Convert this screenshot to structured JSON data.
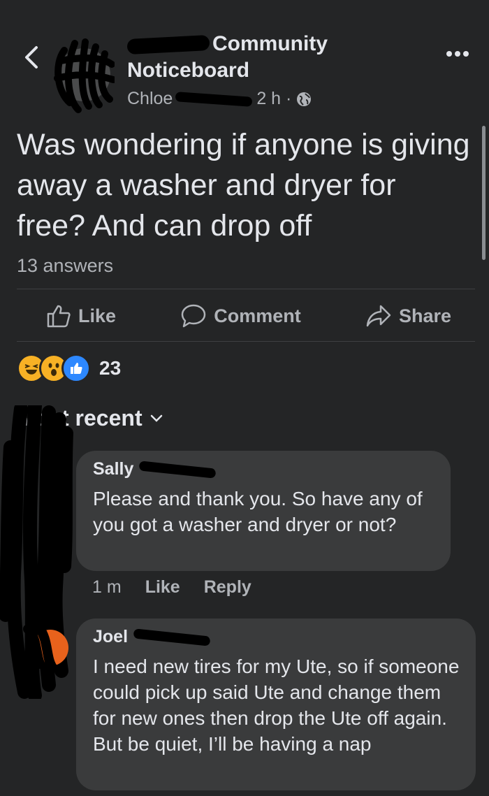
{
  "header": {
    "group_name_line1": "Community",
    "group_name_line2": "Noticeboard",
    "author": "Chloe",
    "time": "2 h ·"
  },
  "post": {
    "text": "Was wondering if anyone is giving away a washer and dryer for free? And can drop off",
    "answers": "13 answers"
  },
  "actions": {
    "like": "Like",
    "comment": "Comment",
    "share": "Share"
  },
  "reactions": {
    "count": "23"
  },
  "sort": {
    "label": "Most recent"
  },
  "comments": [
    {
      "name": "Sally",
      "text": "Please and thank you. So have any of you got a washer and dryer or not?",
      "time": "1 m",
      "like": "Like",
      "reply": "Reply"
    },
    {
      "name": "Joel",
      "text": "I need new tires for my Ute, so if someone could pick up said Ute and change them for new ones then drop the Ute off again. But be quiet, I’ll be having a nap"
    }
  ],
  "colors": {
    "background": "#242526",
    "bubble": "#3a3b3c",
    "text": "#e4e6eb",
    "muted": "#b0b3b8"
  }
}
